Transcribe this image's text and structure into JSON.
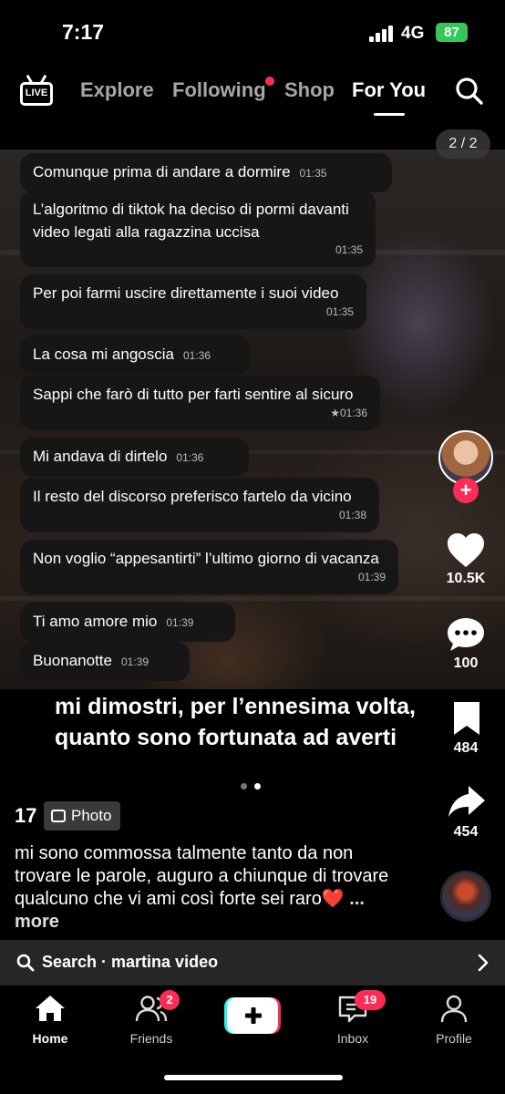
{
  "status": {
    "time": "7:17",
    "network": "4G",
    "battery": "87"
  },
  "topnav": {
    "live_label": "LIVE",
    "tabs": [
      {
        "label": "Explore"
      },
      {
        "label": "Following"
      },
      {
        "label": "Shop"
      },
      {
        "label": "For You"
      }
    ],
    "active_tab": "For You"
  },
  "photo": {
    "counter": "2 / 2",
    "messages": [
      {
        "text": "Comunque prima di andare a dormire",
        "time": "01:35"
      },
      {
        "text": "L’algoritmo di tiktok ha deciso di pormi davanti video legati alla ragazzina uccisa",
        "time": "01:35"
      },
      {
        "text": "Per poi farmi uscire direttamente i suoi video",
        "time": "01:35"
      },
      {
        "text": "La cosa mi angoscia",
        "time": "01:36"
      },
      {
        "text": "Sappi che farò di tutto per farti sentire al sicuro",
        "time": "★01:36"
      },
      {
        "text": "Mi andava di dirtelo",
        "time": "01:36"
      },
      {
        "text": "Il resto del discorso preferisco fartelo da vicino",
        "time": "01:38"
      },
      {
        "text": "Non voglio “appesantirti” l’ultimo giorno di vacanza",
        "time": "01:39"
      },
      {
        "text": "Ti amo amore mio",
        "time": "01:39"
      },
      {
        "text": "Buonanotte",
        "time": "01:39"
      }
    ],
    "overlay_line1": "mi dimostri, per l’ennesima volta,",
    "overlay_line2": "quanto sono fortunata ad averti",
    "page_dots": {
      "total": 2,
      "current": 2
    }
  },
  "rail": {
    "follow_label": "+",
    "likes": "10.5K",
    "comments": "100",
    "saves": "484",
    "shares": "454"
  },
  "post": {
    "count": "17",
    "type_chip": "Photo",
    "caption": "mi sono commossa talmente tanto da non trovare le parole, auguro a chiunque di trovare qualcuno che vi ami così forte sei raro",
    "heart_emoji": "❤️",
    "more_label": "... more"
  },
  "search_bar": {
    "text": "Search · martina video"
  },
  "tabbar": {
    "tabs": [
      {
        "label": "Home"
      },
      {
        "label": "Friends",
        "badge": "2"
      },
      {
        "label": "Inbox",
        "badge": "19"
      },
      {
        "label": "Profile"
      }
    ],
    "create_label": "+"
  },
  "colors": {
    "accent": "#fe2c55",
    "battery": "#35c759",
    "bubble": "#161616"
  }
}
